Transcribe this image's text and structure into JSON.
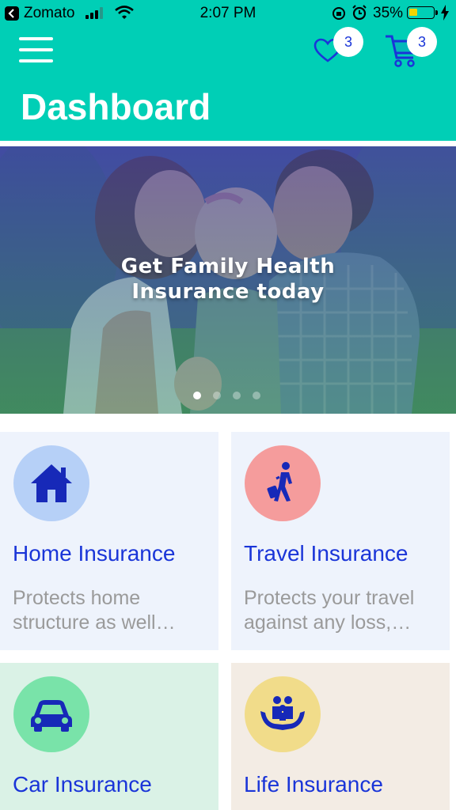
{
  "status_bar": {
    "carrier": "Zomato",
    "time": "2:07 PM",
    "battery_percent": "35%",
    "battery_level": 0.35,
    "battery_color": "#f1d400"
  },
  "header": {
    "title": "Dashboard",
    "background": "#00cfb6",
    "favorites_count": "3",
    "cart_count": "3",
    "icons": [
      "menu-icon",
      "heart-icon",
      "cart-icon"
    ]
  },
  "banner": {
    "caption_line1": "Get Family Health",
    "caption_line2": "Insurance today",
    "slide_count": 4,
    "active_slide": 0
  },
  "cards": [
    {
      "title": "Home Insurance",
      "description": "Protects home structure as well…",
      "icon": "house-icon",
      "circle_color": "#b6d0f7"
    },
    {
      "title": "Travel Insurance",
      "description": "Protects your travel against any loss,…",
      "icon": "traveler-icon",
      "circle_color": "#f59c9c"
    },
    {
      "title": "Car Insurance",
      "description": "",
      "icon": "car-icon",
      "circle_color": "#79e3a9"
    },
    {
      "title": "Life Insurance",
      "description": "",
      "icon": "family-care-icon",
      "circle_color": "#f1dc8a"
    }
  ],
  "colors": {
    "accent_blue": "#1a35d8",
    "muted_text": "#9a9a9a"
  }
}
